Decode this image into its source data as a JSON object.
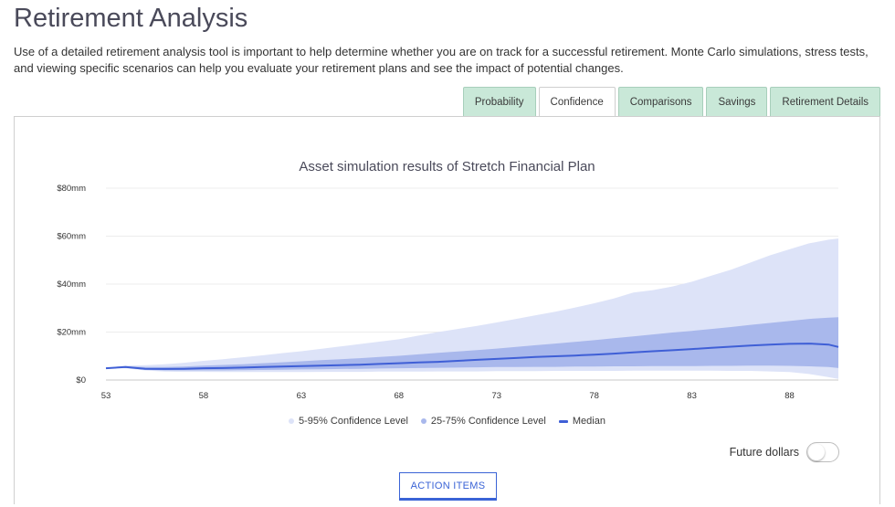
{
  "page": {
    "title": "Retirement Analysis",
    "intro": "Use of a detailed retirement analysis tool is important to help determine whether you are on track for a successful retirement. Monte Carlo simulations, stress tests, and viewing specific scenarios can help you evaluate your retirement plans and see the impact of potential changes."
  },
  "tabs": [
    {
      "label": "Probability",
      "active": false
    },
    {
      "label": "Confidence",
      "active": true
    },
    {
      "label": "Comparisons",
      "active": false
    },
    {
      "label": "Savings",
      "active": false
    },
    {
      "label": "Retirement Details",
      "active": false
    }
  ],
  "legend": {
    "band_95": "5-95% Confidence Level",
    "band_75": "25-75% Confidence Level",
    "median": "Median"
  },
  "future_dollars": {
    "label": "Future dollars",
    "on": false
  },
  "action_button": "ACTION ITEMS",
  "colors": {
    "band_95": "#dde3f8",
    "band_75": "#a9b8ec",
    "median": "#3f5fd6",
    "tab_bg": "#c9e8d8",
    "accent": "#3a63d6"
  },
  "chart_data": {
    "type": "area",
    "title": "Asset simulation results of Stretch Financial Plan",
    "xlabel": "",
    "ylabel": "",
    "x_ticks": [
      "53",
      "58",
      "63",
      "68",
      "73",
      "78",
      "83",
      "88"
    ],
    "y_ticks": [
      "$0",
      "$20mm",
      "$40mm",
      "$60mm",
      "$80mm"
    ],
    "xlim": [
      53,
      90.5
    ],
    "ylim": [
      0,
      80
    ],
    "grid": true,
    "legend_position": "bottom",
    "x": [
      53,
      54,
      55,
      56,
      57,
      58,
      59,
      60,
      61,
      62,
      63,
      64,
      65,
      66,
      67,
      68,
      69,
      70,
      71,
      72,
      73,
      74,
      75,
      76,
      77,
      78,
      79,
      80,
      81,
      82,
      83,
      84,
      85,
      86,
      87,
      88,
      89,
      90,
      90.5
    ],
    "series": [
      {
        "name": "5-95% Confidence Level",
        "role": "band",
        "low": [
          4.8,
          4.9,
          4.0,
          3.5,
          3.4,
          3.4,
          3.3,
          3.3,
          3.3,
          3.3,
          3.3,
          3.4,
          3.4,
          3.4,
          3.5,
          3.5,
          3.5,
          3.6,
          3.6,
          3.6,
          3.7,
          3.7,
          3.7,
          3.8,
          3.8,
          3.8,
          3.8,
          3.9,
          3.9,
          3.9,
          3.9,
          3.9,
          3.8,
          3.8,
          3.6,
          3.3,
          2.5,
          1.2,
          0.5
        ],
        "high": [
          5.0,
          6.0,
          6.2,
          6.6,
          7.2,
          8.0,
          8.7,
          9.5,
          10.3,
          11.2,
          12.0,
          13.0,
          14.0,
          15.0,
          16.0,
          17.0,
          18.5,
          20.0,
          21.3,
          22.6,
          24.0,
          25.5,
          27.0,
          28.5,
          30.2,
          32.0,
          34.0,
          36.5,
          37.5,
          39.0,
          41.0,
          43.5,
          46.0,
          49.0,
          52.0,
          54.5,
          57.0,
          58.5,
          59.0
        ]
      },
      {
        "name": "25-75% Confidence Level",
        "role": "band",
        "low": [
          4.9,
          5.1,
          4.3,
          4.0,
          4.0,
          4.0,
          4.0,
          4.1,
          4.2,
          4.3,
          4.4,
          4.5,
          4.6,
          4.7,
          4.8,
          4.9,
          5.0,
          5.1,
          5.2,
          5.3,
          5.4,
          5.4,
          5.5,
          5.5,
          5.6,
          5.6,
          5.7,
          5.7,
          5.8,
          5.8,
          5.8,
          5.9,
          5.9,
          6.0,
          6.0,
          5.9,
          5.7,
          5.4,
          5.0
        ]
      },
      {
        "name": "25-75% upper",
        "role": "band-high",
        "high": [
          5.0,
          5.7,
          5.4,
          5.4,
          5.6,
          6.0,
          6.3,
          6.6,
          7.0,
          7.4,
          7.8,
          8.3,
          8.7,
          9.1,
          9.6,
          10.1,
          10.7,
          11.3,
          11.9,
          12.5,
          13.1,
          13.8,
          14.5,
          15.2,
          15.9,
          16.6,
          17.4,
          18.2,
          19.0,
          19.8,
          20.5,
          21.3,
          22.1,
          23.0,
          23.8,
          24.6,
          25.5,
          26.0,
          26.2
        ]
      },
      {
        "name": "Median",
        "role": "line",
        "values": [
          4.9,
          5.4,
          4.7,
          4.6,
          4.7,
          4.9,
          5.0,
          5.2,
          5.4,
          5.6,
          5.8,
          6.0,
          6.2,
          6.4,
          6.7,
          7.0,
          7.3,
          7.6,
          8.0,
          8.4,
          8.8,
          9.2,
          9.6,
          9.9,
          10.2,
          10.6,
          11.0,
          11.5,
          12.0,
          12.4,
          12.9,
          13.4,
          13.9,
          14.4,
          14.8,
          15.1,
          15.2,
          14.8,
          13.8
        ]
      }
    ]
  }
}
